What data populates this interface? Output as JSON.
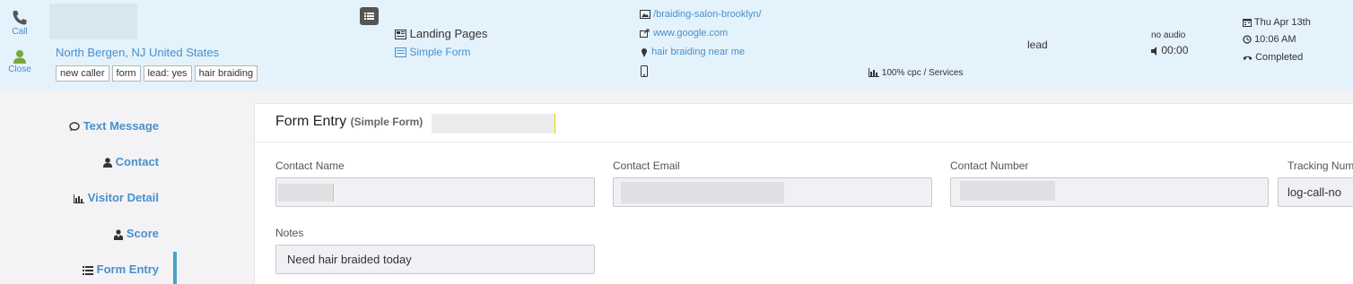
{
  "header": {
    "call_label": "Call",
    "close_label": "Close",
    "location": "North Bergen, NJ United States",
    "tags": [
      "new caller",
      "form",
      "lead: yes",
      "hair braiding"
    ],
    "landing_pages_label": "Landing Pages",
    "simple_form_link": "Simple Form",
    "landing_url": "/braiding-salon-brooklyn/",
    "referrer": "www.google.com",
    "keyword": "hair braiding near me",
    "campaign": "100% cpc / Services",
    "status_lead": "lead",
    "audio_label": "no audio",
    "duration": "00:00",
    "date": "Thu Apr 13th",
    "time": "10:06 AM",
    "call_status": "Completed"
  },
  "sidebar": {
    "items": [
      {
        "label": "Text Message",
        "icon": "speech-bubble-icon"
      },
      {
        "label": "Contact",
        "icon": "user-icon"
      },
      {
        "label": "Visitor Detail",
        "icon": "bar-chart-icon"
      },
      {
        "label": "Score",
        "icon": "user-tie-icon"
      },
      {
        "label": "Form Entry",
        "icon": "list-icon"
      }
    ]
  },
  "form": {
    "title": "Form Entry",
    "subtitle": "(Simple Form)",
    "fields": {
      "contact_name_label": "Contact Name",
      "contact_email_label": "Contact Email",
      "contact_number_label": "Contact Number",
      "tracking_number_label": "Tracking Num",
      "tracking_number_value": "log-call-no",
      "notes_label": "Notes",
      "notes_value": "Need hair braided today"
    }
  },
  "colors": {
    "header_bg": "#e4f2fc",
    "link": "#4a90c9",
    "active_indicator": "#4aa3c9",
    "call_icon": "#555555",
    "close_icon": "#7aa63a"
  }
}
